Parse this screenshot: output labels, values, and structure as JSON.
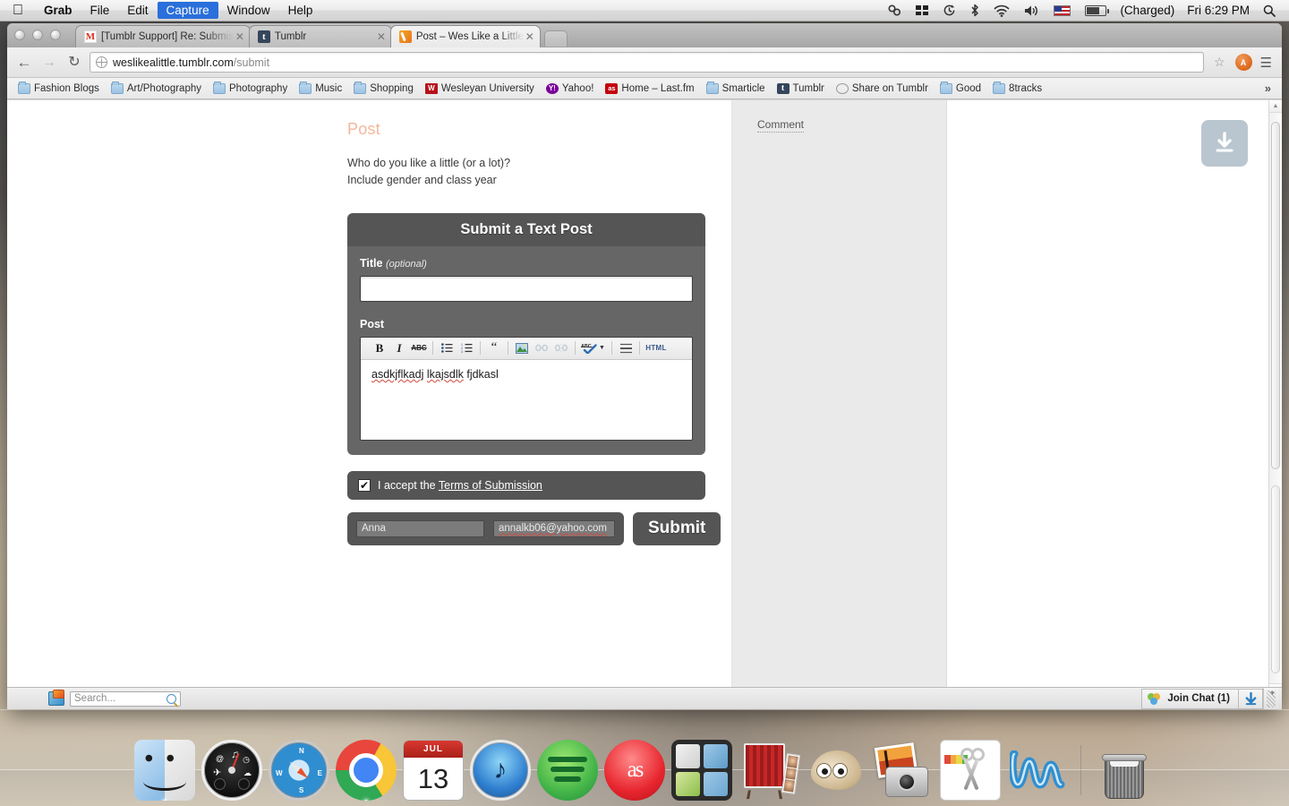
{
  "menubar": {
    "apple_icon": "apple-icon",
    "items": [
      {
        "label": "Grab",
        "active": false,
        "bold": true
      },
      {
        "label": "File",
        "active": false
      },
      {
        "label": "Edit",
        "active": false
      },
      {
        "label": "Capture",
        "active": true
      },
      {
        "label": "Window",
        "active": false
      },
      {
        "label": "Help",
        "active": false
      }
    ],
    "status": {
      "link_icon": "chain-link-icon",
      "dropbox_icon": "dropbox-icon",
      "timemachine_icon": "time-machine-icon",
      "bluetooth_icon": "bluetooth-icon",
      "wifi_icon": "wifi-icon",
      "volume_icon": "volume-icon",
      "flag_icon": "us-flag-icon",
      "battery_icon": "battery-icon",
      "battery_label": "(Charged)",
      "clock": "Fri 6:29 PM",
      "spotlight_icon": "spotlight-search-icon"
    }
  },
  "browser": {
    "tabs": [
      {
        "title": "[Tumblr Support] Re: Submis",
        "favicon": "gmail-icon",
        "active": false
      },
      {
        "title": "Tumblr",
        "favicon": "tumblr-icon",
        "active": false
      },
      {
        "title": "Post – Wes Like a Little",
        "favicon": "wes-like-a-little-icon",
        "active": true
      }
    ],
    "new_tab_label": "",
    "nav": {
      "back_icon": "back-arrow-icon",
      "forward_icon": "forward-arrow-icon",
      "reload_icon": "reload-icon",
      "star_icon": "bookmark-star-icon",
      "profile_label": "A",
      "wrench_icon": "wrench-menu-icon"
    },
    "omnibox": {
      "site_icon": "globe-icon",
      "host": "weslikealittle.tumblr.com",
      "path": "/submit"
    },
    "bookmarks": [
      {
        "label": "Fashion Blogs",
        "icon": "folder-icon"
      },
      {
        "label": "Art/Photography",
        "icon": "folder-icon"
      },
      {
        "label": "Photography",
        "icon": "folder-icon"
      },
      {
        "label": "Music",
        "icon": "folder-icon"
      },
      {
        "label": "Shopping",
        "icon": "folder-icon"
      },
      {
        "label": "Wesleyan University",
        "icon": "wesleyan-icon"
      },
      {
        "label": "Yahoo!",
        "icon": "yahoo-icon"
      },
      {
        "label": "Home – Last.fm",
        "icon": "lastfm-icon"
      },
      {
        "label": "Smarticle",
        "icon": "folder-icon"
      },
      {
        "label": "Tumblr",
        "icon": "tumblr-icon"
      },
      {
        "label": "Share on Tumblr",
        "icon": "globe-icon"
      },
      {
        "label": "Good",
        "icon": "folder-icon"
      },
      {
        "label": "8tracks",
        "icon": "folder-icon"
      }
    ],
    "bookmarks_overflow": "»"
  },
  "page": {
    "heading": "Post",
    "prompt_line1": "Who do you like a little (or a lot)?",
    "prompt_line2": "Include gender and class year",
    "form": {
      "header": "Submit a Text Post",
      "title_label": "Title",
      "title_optional": "(optional)",
      "title_value": "",
      "post_label": "Post",
      "editor_text": "asdkjflkadj lkajsdlk fjdkasl",
      "editor_misspelled": [
        "asdkjflkadj",
        "lkajsdlk"
      ],
      "toolbar": [
        {
          "name": "bold-icon",
          "glyph": "B"
        },
        {
          "name": "italic-icon",
          "glyph": "I"
        },
        {
          "name": "strikethrough-icon",
          "glyph": "ABC"
        },
        {
          "name": "unordered-list-icon",
          "glyph": "≡"
        },
        {
          "name": "ordered-list-icon",
          "glyph": "≡"
        },
        {
          "name": "blockquote-icon",
          "glyph": "“"
        },
        {
          "name": "insert-image-icon",
          "glyph": "🌳"
        },
        {
          "name": "insert-link-icon",
          "glyph": "🔗",
          "disabled": true
        },
        {
          "name": "unlink-icon",
          "glyph": "⛓",
          "disabled": true
        },
        {
          "name": "spellcheck-icon",
          "glyph": "ABC"
        },
        {
          "name": "spellcheck-dropdown-icon",
          "glyph": "▾"
        },
        {
          "name": "horizontal-rule-icon",
          "glyph": "═"
        },
        {
          "name": "html-source-button",
          "glyph": "HTML"
        }
      ],
      "accept_prefix": "I accept the ",
      "accept_link": "Terms of Submission",
      "accept_checked": true,
      "name_value": "Anna",
      "email_value": "annalkb06@yahoo.com",
      "submit_label": "Submit"
    },
    "sidebar": {
      "comment_label": "Comment"
    },
    "download_widget_icon": "download-icon"
  },
  "chatbar": {
    "app_icon": "tumblr-app-icon",
    "search_placeholder": "Search...",
    "search_icon": "magnifier-icon",
    "join_chat_label": "Join Chat (1)",
    "join_chat_icon": "people-icon",
    "download_icon": "download-arrow-icon"
  },
  "dock": {
    "items": [
      {
        "name": "finder",
        "label": "Finder",
        "running": true
      },
      {
        "name": "dashboard",
        "label": "Dashboard",
        "running": false
      },
      {
        "name": "safari",
        "label": "Safari",
        "running": false
      },
      {
        "name": "chrome",
        "label": "Google Chrome",
        "running": true
      },
      {
        "name": "calendar",
        "label": "Calendar",
        "month": "JUL",
        "day": "13",
        "running": false
      },
      {
        "name": "itunes",
        "label": "iTunes",
        "running": false
      },
      {
        "name": "spotify",
        "label": "Spotify",
        "running": false
      },
      {
        "name": "lastfm",
        "label": "Last.fm",
        "running": false
      },
      {
        "name": "mission-control",
        "label": "Mission Control",
        "running": false
      },
      {
        "name": "photo-booth",
        "label": "Photo Booth",
        "running": false
      },
      {
        "name": "gimp",
        "label": "GIMP",
        "running": false
      },
      {
        "name": "iphoto",
        "label": "iPhoto",
        "running": false
      },
      {
        "name": "grab",
        "label": "Grab",
        "running": true
      },
      {
        "name": "wesleyan",
        "label": "Wesleyan",
        "running": false
      },
      {
        "name": "trash",
        "label": "Trash",
        "running": false
      }
    ]
  },
  "colors": {
    "accent_heading": "#f2b79c",
    "form_dark": "#555555",
    "form_body": "#666666",
    "menubar_highlight": "#2a6fdb",
    "spellcheck_red": "#d04a3a"
  }
}
